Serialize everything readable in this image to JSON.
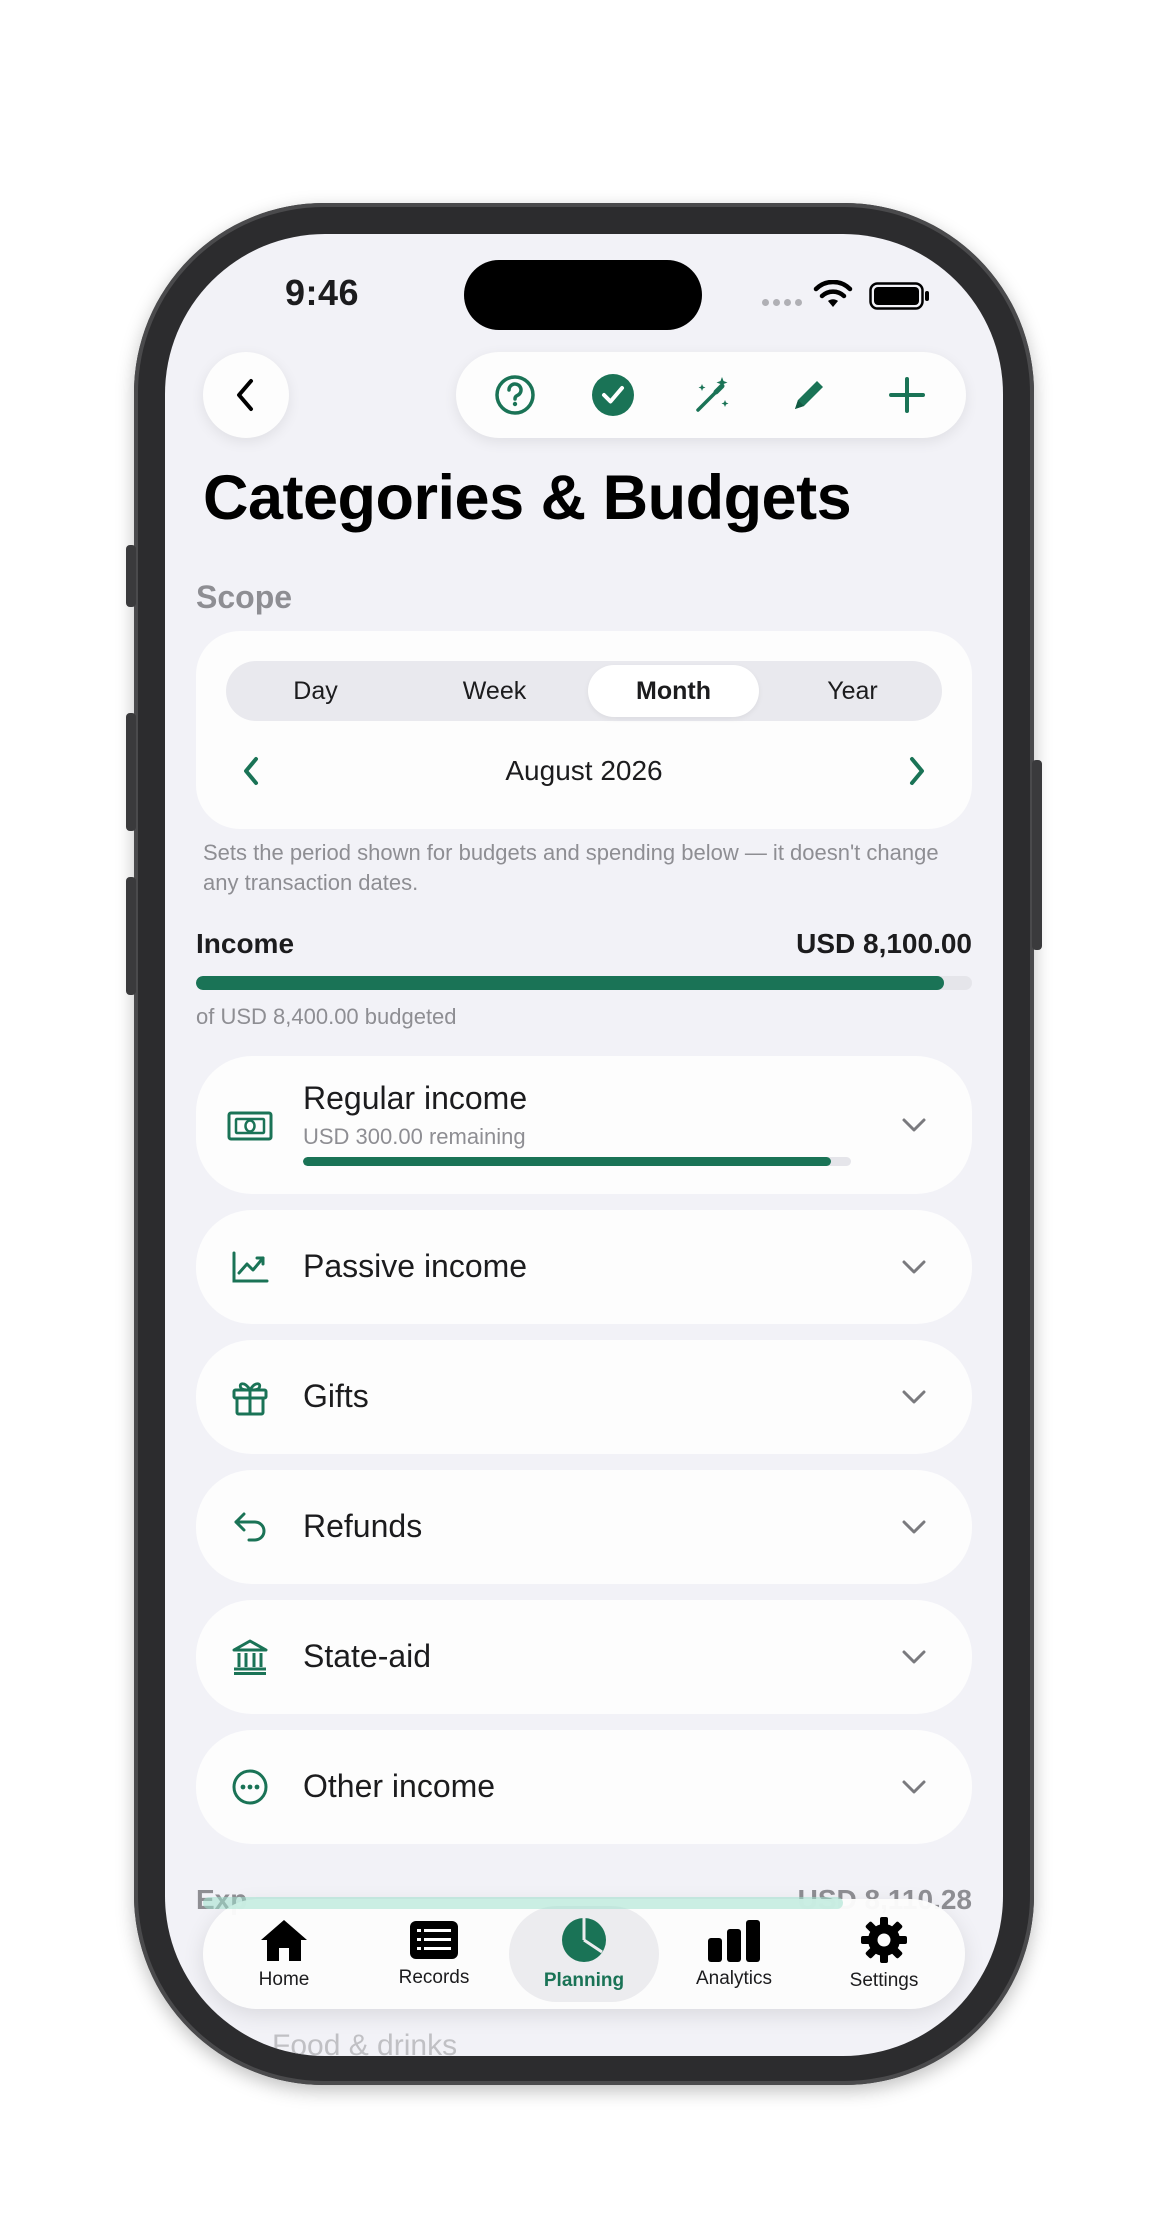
{
  "status_bar": {
    "time": "9:46"
  },
  "toolbar": {
    "back_icon": "chevron-left-icon",
    "actions": [
      "help-icon",
      "check-circle-icon",
      "magic-wand-icon",
      "pencil-icon",
      "plus-icon"
    ]
  },
  "page": {
    "title": "Categories & Budgets"
  },
  "scope": {
    "label": "Scope",
    "segments": [
      "Day",
      "Week",
      "Month",
      "Year"
    ],
    "selected": "Month",
    "period": "August 2026",
    "hint": "Sets the period shown for budgets and spending below — it doesn't change any transaction dates."
  },
  "income": {
    "title": "Income",
    "total": "USD 8,100.00",
    "budgeted": "of USD 8,400.00 budgeted",
    "progress": 0.964
  },
  "categories": [
    {
      "name": "Regular income",
      "subtitle": "USD 300.00 remaining",
      "progress": 0.964,
      "icon": "banknote-icon"
    },
    {
      "name": "Passive income",
      "icon": "trend-chart-icon"
    },
    {
      "name": "Gifts",
      "icon": "gift-icon"
    },
    {
      "name": "Refunds",
      "icon": "return-arrow-icon"
    },
    {
      "name": "State-aid",
      "icon": "bank-building-icon"
    },
    {
      "name": "Other income",
      "icon": "more-circle-icon"
    }
  ],
  "peek": {
    "expenses_label": "Exp",
    "expenses_total": "USD 8,110.28",
    "first_category": "Food & drinks"
  },
  "tabbar": {
    "tabs": [
      {
        "label": "Home",
        "icon": "home-icon"
      },
      {
        "label": "Records",
        "icon": "records-list-icon"
      },
      {
        "label": "Planning",
        "icon": "pie-chart-icon"
      },
      {
        "label": "Analytics",
        "icon": "bar-chart-icon"
      },
      {
        "label": "Settings",
        "icon": "gear-icon"
      }
    ],
    "selected": "Planning"
  },
  "colors": {
    "accent": "#1a7356",
    "background": "#f2f2f7",
    "card": "#fdfdfd"
  }
}
